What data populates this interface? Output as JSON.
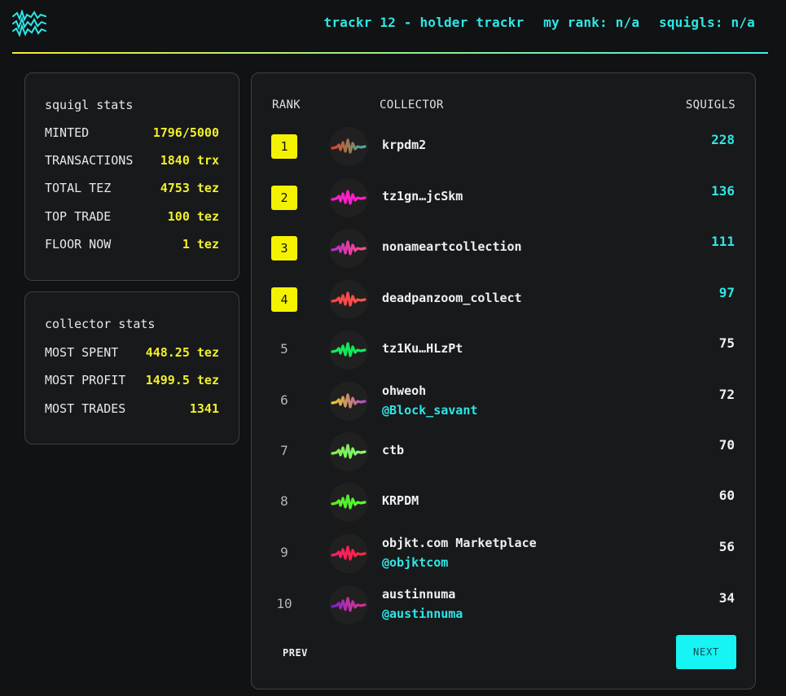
{
  "header": {
    "title": "trackr 12 - holder trackr",
    "my_rank": "my rank: n/a",
    "squigls": "squigls: n/a"
  },
  "squigl_stats": {
    "title": "squigl stats",
    "rows": [
      {
        "label": "MINTED",
        "value": "1796/5000"
      },
      {
        "label": "TRANSACTIONS",
        "value": "1840 trx"
      },
      {
        "label": "TOTAL TEZ",
        "value": "4753 tez"
      },
      {
        "label": "TOP TRADE",
        "value": "100 tez"
      },
      {
        "label": "FLOOR NOW",
        "value": "1 tez"
      }
    ]
  },
  "collector_stats": {
    "title": "collector stats",
    "rows": [
      {
        "label": "MOST SPENT",
        "value": "448.25 tez"
      },
      {
        "label": "MOST PROFIT",
        "value": "1499.5 tez"
      },
      {
        "label": "MOST TRADES",
        "value": "1341"
      }
    ]
  },
  "table": {
    "headers": {
      "rank": "RANK",
      "collector": "COLLECTOR",
      "squigls": "SQUIGLS"
    },
    "rows": [
      {
        "rank": "1",
        "name": "krpdm2",
        "handle": "",
        "count": "228",
        "highlight": true,
        "colors": [
          "#e0402a",
          "#9a7a55",
          "#3fb0a6"
        ]
      },
      {
        "rank": "2",
        "name": "tz1gn…jcSkm",
        "handle": "",
        "count": "136",
        "highlight": true,
        "colors": [
          "#ff1ec8",
          "#ff1ec8",
          "#ff1ec8"
        ]
      },
      {
        "rank": "3",
        "name": "nonameartcollection",
        "handle": "",
        "count": "111",
        "highlight": true,
        "colors": [
          "#b02ed0",
          "#e83aa8",
          "#ff4f8a"
        ]
      },
      {
        "rank": "4",
        "name": "deadpanzoom_collect",
        "handle": "",
        "count": "97",
        "highlight": true,
        "colors": [
          "#ff4040",
          "#ff4a4a",
          "#ff5555"
        ]
      },
      {
        "rank": "5",
        "name": "tz1Ku…HLzPt",
        "handle": "",
        "count": "75",
        "highlight": false,
        "colors": [
          "#14e85a",
          "#14e85a",
          "#14e85a"
        ]
      },
      {
        "rank": "6",
        "name": "ohweoh",
        "handle": "@Block_savant",
        "count": "72",
        "highlight": false,
        "colors": [
          "#e8d02a",
          "#c88a6a",
          "#b04ad0"
        ]
      },
      {
        "rank": "7",
        "name": "ctb",
        "handle": "",
        "count": "70",
        "highlight": false,
        "colors": [
          "#8af046",
          "#7af060",
          "#8aff70"
        ]
      },
      {
        "rank": "8",
        "name": "KRPDM",
        "handle": "",
        "count": "60",
        "highlight": false,
        "colors": [
          "#60f020",
          "#50f030",
          "#60ff30"
        ]
      },
      {
        "rank": "9",
        "name": "objkt.com Marketplace",
        "handle": "@objktcom",
        "count": "56",
        "highlight": false,
        "colors": [
          "#ff1e6a",
          "#ff2050",
          "#ff2a4a"
        ]
      },
      {
        "rank": "10",
        "name": "austinnuma",
        "handle": "@austinnuma",
        "count": "34",
        "highlight": false,
        "colors": [
          "#7a20d0",
          "#c030a8",
          "#d03090"
        ]
      }
    ]
  },
  "pagination": {
    "prev": "PREV",
    "next": "NEXT"
  },
  "colors": {
    "accent_cyan": "#2ee6e6",
    "accent_yellow": "#f3ef2c",
    "badge": "#f5f200",
    "next_button": "#16f4f4"
  }
}
